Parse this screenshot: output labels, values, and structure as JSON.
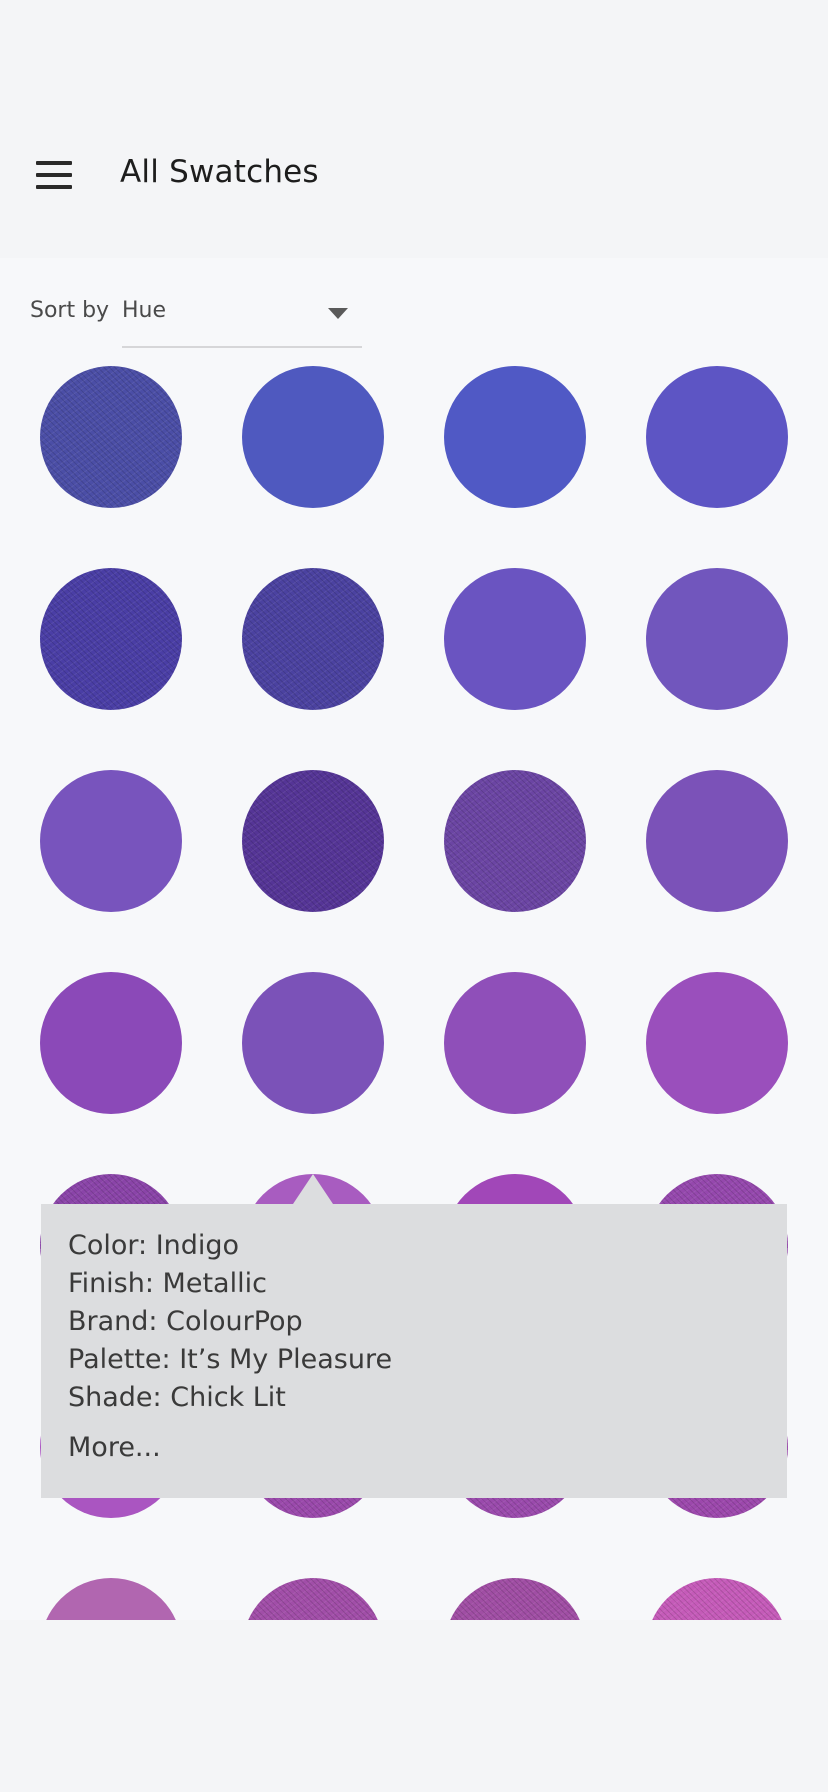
{
  "header": {
    "title": "All Swatches",
    "menu_icon": "hamburger-menu-icon"
  },
  "sort": {
    "label": "Sort by",
    "selected": "Hue",
    "caret_icon": "dropdown-caret-icon"
  },
  "swatches": [
    {
      "color": "#4b4ea6",
      "textured": true
    },
    {
      "color": "#4f59bf",
      "textured": false
    },
    {
      "color": "#5059c5",
      "textured": false
    },
    {
      "color": "#5d55c4",
      "textured": false
    },
    {
      "color": "#4a3ea5",
      "textured": true
    },
    {
      "color": "#4b42a0",
      "textured": true
    },
    {
      "color": "#6a54c1",
      "textured": false
    },
    {
      "color": "#7156bd",
      "textured": false
    },
    {
      "color": "#7854bd",
      "textured": false
    },
    {
      "color": "#553596",
      "textured": true
    },
    {
      "color": "#6b45a3",
      "textured": true
    },
    {
      "color": "#7b52b8",
      "textured": false
    },
    {
      "color": "#8b49b8",
      "textured": false
    },
    {
      "color": "#7b52b8",
      "textured": false
    },
    {
      "color": "#8f4fb9",
      "textured": false
    },
    {
      "color": "#9a4fbc",
      "textured": false
    },
    {
      "color": "#8a44a8",
      "textured": true
    },
    {
      "color": "#a85cc0",
      "textured": false
    },
    {
      "color": "#a147b8",
      "textured": false
    },
    {
      "color": "#9548ad",
      "textured": true
    },
    {
      "color": "#aa55c1",
      "textured": false
    },
    {
      "color": "#9a49ab",
      "textured": true
    },
    {
      "color": "#9a4aac",
      "textured": true
    },
    {
      "color": "#9c48ac",
      "textured": true
    },
    {
      "color": "#b166b0",
      "textured": false
    },
    {
      "color": "#a14ea8",
      "textured": true
    },
    {
      "color": "#a04ea4",
      "textured": true
    },
    {
      "color": "#c55bb9",
      "textured": true
    }
  ],
  "tooltip": {
    "lines": [
      "Color: Indigo",
      "Finish: Metallic",
      "Brand: ColourPop",
      "Palette: It’s My Pleasure",
      "Shade: Chick Lit"
    ],
    "more": "More..."
  },
  "fab": {
    "icon": "plus-icon",
    "color": "#52a391"
  }
}
